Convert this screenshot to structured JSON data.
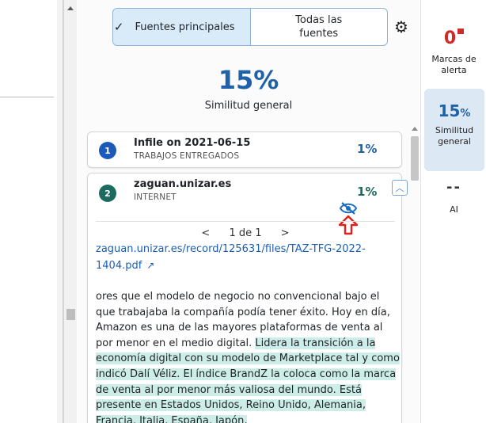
{
  "filters": {
    "primary_label": "Fuentes principales",
    "all_label": "Todas las fuentes",
    "check_icon": "check-icon",
    "settings_icon": "gear-icon"
  },
  "summary": {
    "similarity_pct": "15%",
    "similarity_label": "Similitud general"
  },
  "sources": [
    {
      "number": "1",
      "title": "Infile on 2021-06-15",
      "type": "TRABAJOS ENTREGADOS",
      "pct": "1%",
      "color": "#1b5ab8"
    },
    {
      "number": "2",
      "title": "zaguan.unizar.es",
      "type": "INTERNET",
      "pct": "1%",
      "color": "#1d6b60",
      "pager_prev": "<",
      "pager_text": "1 de 1",
      "pager_next": ">",
      "url": "zaguan.unizar.es/record/125631/files/TAZ-TFG-2022-1404.pdf",
      "excerpt_plain": "ores que el modelo de negocio no convencional bajo el que trabajaba la compañía podía tener éxito. Hoy en día, Amazon es una de las mayores plataformas de venta al por menor en el medio digital. ",
      "excerpt_highlight": "Lidera la transición a la economía digital con su modelo de Marketplace tal y como indicó Dalí Véliz. El índice BrandZ la coloca como la marca de venta al por menor más valiosa del mundo. Está presente en Estados Unidos, Reino Unido, Alemania, Francia, Italia, España, Japón,"
    }
  ],
  "rail": {
    "alerts_count": "0",
    "alerts_label": "Marcas de alerta",
    "similarity_value": "15",
    "similarity_unit": "%",
    "similarity_label": "Similitud general",
    "ai_value": "--",
    "ai_label": "AI"
  },
  "colors": {
    "accent": "#1f62a9",
    "alert": "#cf2a2a",
    "highlight": "#cdeee8"
  }
}
